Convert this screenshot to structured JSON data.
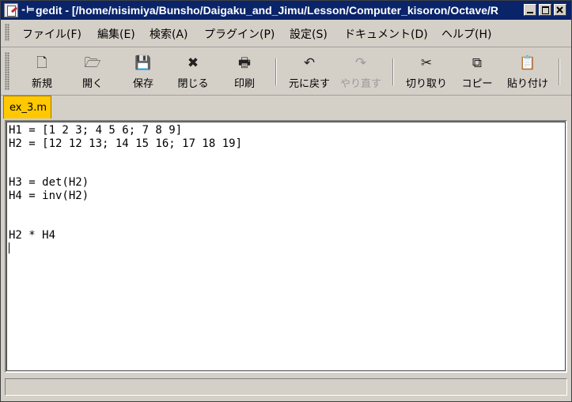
{
  "titlebar": {
    "title": "gedit - [/home/nisimiya/Bunsho/Daigaku_and_Jimu/Lesson/Computer_kisoron/Octave/R",
    "pin": "-⊨"
  },
  "menu": [
    {
      "label": "ファイル(F)"
    },
    {
      "label": "編集(E)"
    },
    {
      "label": "検索(A)"
    },
    {
      "label": "プラグイン(P)"
    },
    {
      "label": "設定(S)"
    },
    {
      "label": "ドキュメント(D)"
    },
    {
      "label": "ヘルプ(H)"
    }
  ],
  "toolbar": [
    {
      "label": "新規",
      "icon": "new-document-icon",
      "glyph": "🗋"
    },
    {
      "label": "開く",
      "icon": "open-folder-icon",
      "glyph": "🗁"
    },
    {
      "label": "保存",
      "icon": "save-disk-icon",
      "glyph": "💾"
    },
    {
      "label": "閉じる",
      "icon": "close-x-icon",
      "glyph": "✖"
    },
    {
      "label": "印刷",
      "icon": "printer-icon",
      "glyph": "🖶"
    },
    {
      "label": "元に戻す",
      "icon": "undo-icon",
      "glyph": "↶"
    },
    {
      "label": "やり直す",
      "icon": "redo-icon",
      "glyph": "↷",
      "disabled": true
    },
    {
      "label": "切り取り",
      "icon": "scissors-icon",
      "glyph": "✂"
    },
    {
      "label": "コピー",
      "icon": "copy-icon",
      "glyph": "⧉"
    },
    {
      "label": "貼り付け",
      "icon": "paste-icon",
      "glyph": "📋"
    }
  ],
  "tab": {
    "label": "ex_3.m"
  },
  "editor": {
    "lines": [
      "H1 = [1 2 3; 4 5 6; 7 8 9]",
      "H2 = [12 12 13; 14 15 16; 17 18 19]",
      "",
      "",
      "H3 = det(H2)",
      "H4 = inv(H2)",
      "",
      "",
      "H2 * H4",
      ""
    ]
  },
  "status": {
    "text": ""
  }
}
